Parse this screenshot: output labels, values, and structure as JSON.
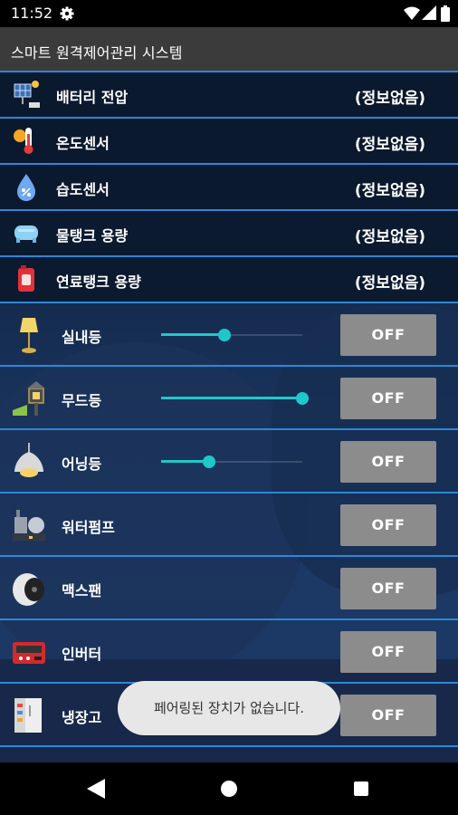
{
  "status_bar": {
    "time": "11:52",
    "icons": [
      "gear-icon",
      "wifi-icon",
      "signal-icon",
      "battery-icon"
    ]
  },
  "app": {
    "title": "스마트 원격제어관리 시스템"
  },
  "info_rows": [
    {
      "label": "배터리 전압",
      "value": "(정보없음)",
      "icon": "solar-panel-icon"
    },
    {
      "label": "온도센서",
      "value": "(정보없음)",
      "icon": "thermometer-icon"
    },
    {
      "label": "습도센서",
      "value": "(정보없음)",
      "icon": "water-drop-icon"
    },
    {
      "label": "물탱크 용량",
      "value": "(정보없음)",
      "icon": "water-tank-icon"
    },
    {
      "label": "연료탱크 용량",
      "value": "(정보없음)",
      "icon": "fuel-tank-icon"
    }
  ],
  "control_rows": [
    {
      "label": "실내등",
      "button": "OFF",
      "icon": "floor-lamp-icon",
      "slider_level": 0.45
    },
    {
      "label": "무드등",
      "button": "OFF",
      "icon": "mood-lamp-icon",
      "slider_level": 1.0
    },
    {
      "label": "어닝등",
      "button": "OFF",
      "icon": "pendant-lamp-icon",
      "slider_level": 0.34
    },
    {
      "label": "워터펌프",
      "button": "OFF",
      "icon": "water-pump-icon"
    },
    {
      "label": "맥스팬",
      "button": "OFF",
      "icon": "fan-icon"
    },
    {
      "label": "인버터",
      "button": "OFF",
      "icon": "inverter-icon"
    },
    {
      "label": "냉장고",
      "button": "OFF",
      "icon": "refrigerator-icon"
    }
  ],
  "toast": {
    "message": "페어링된 장치가 없습니다."
  },
  "colors": {
    "accent": "#1fc8c8",
    "divider": "#2b88d8",
    "button_off": "#8c8c8c"
  }
}
